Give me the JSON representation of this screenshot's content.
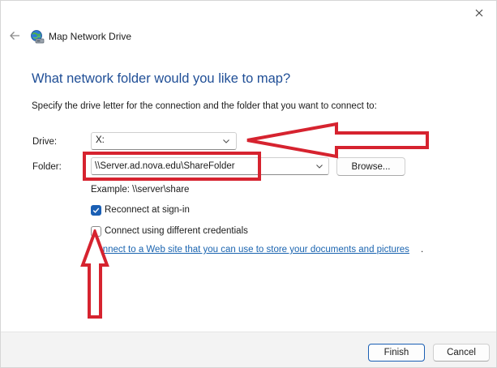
{
  "window": {
    "title": "Map Network Drive"
  },
  "dialog": {
    "heading": "What network folder would you like to map?",
    "instructions": "Specify the drive letter for the connection and the folder that you want to connect to:",
    "drive_label": "Drive:",
    "drive_value": "X:",
    "folder_label": "Folder:",
    "folder_value": "\\\\Server.ad.nova.edu\\ShareFolder",
    "browse_label": "Browse...",
    "example_text": "Example: \\\\server\\share",
    "reconnect_label": "Reconnect at sign-in",
    "reconnect_checked": true,
    "credentials_label": "Connect using different credentials",
    "credentials_checked": false,
    "link_text": "Connect to a Web site that you can use to store your documents and pictures",
    "link_suffix": "."
  },
  "footer": {
    "finish_label": "Finish",
    "cancel_label": "Cancel"
  },
  "icons": {
    "close": "close-icon",
    "back": "back-arrow-icon",
    "app": "network-drive-icon",
    "dropdown": "chevron-down-icon",
    "check": "checkmark-icon"
  },
  "colors": {
    "heading": "#1f4e96",
    "link": "#1a64b0",
    "accent": "#1a5fb4",
    "annotation": "#d6232f"
  }
}
